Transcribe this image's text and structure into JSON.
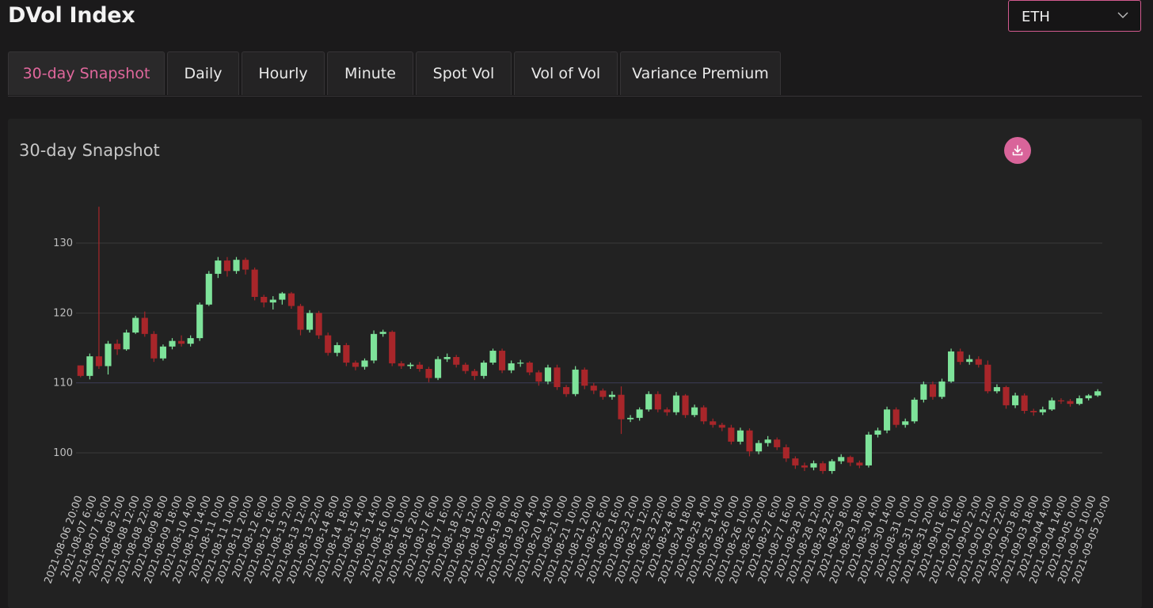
{
  "app": {
    "title": "DVol Index"
  },
  "asset_select": {
    "value": "ETH",
    "icon": "chevron-down-icon"
  },
  "tabs": [
    {
      "label": "30-day Snapshot",
      "active": true
    },
    {
      "label": "Daily",
      "active": false
    },
    {
      "label": "Hourly",
      "active": false
    },
    {
      "label": "Minute",
      "active": false
    },
    {
      "label": "Spot Vol",
      "active": false
    },
    {
      "label": "Vol of Vol",
      "active": false
    },
    {
      "label": "Variance Premium",
      "active": false
    }
  ],
  "panel": {
    "title": "30-day Snapshot",
    "download_icon": "download-icon"
  },
  "colors": {
    "accent": "#e0679c",
    "up": "#7ee39a",
    "down": "#a8262a",
    "grid": "#3a3a3a",
    "highlight_grid": "#3d3d56"
  },
  "chart_data": {
    "type": "candlestick",
    "title": "30-day Snapshot",
    "xlabel": "",
    "ylabel": "",
    "ylim": [
      93,
      137
    ],
    "yticks": [
      100,
      110,
      120,
      130
    ],
    "grid": true,
    "x_start": "2021-08-06 20:00",
    "x_interval_hours": 2,
    "xtick_labels": [
      "2021-08-06  20:00",
      "2021-08-07  6:00",
      "2021-08-07  16:00",
      "2021-08-08  2:00",
      "2021-08-08  12:00",
      "2021-08-08  22:00",
      "2021-08-09  8:00",
      "2021-08-09  18:00",
      "2021-08-10  4:00",
      "2021-08-10  14:00",
      "2021-08-11  0:00",
      "2021-08-11  10:00",
      "2021-08-11  20:00",
      "2021-08-12  6:00",
      "2021-08-12  16:00",
      "2021-08-13  2:00",
      "2021-08-13  12:00",
      "2021-08-13  22:00",
      "2021-08-14  8:00",
      "2021-08-14  18:00",
      "2021-08-15  4:00",
      "2021-08-15  14:00",
      "2021-08-16  0:00",
      "2021-08-16  10:00",
      "2021-08-16  20:00",
      "2021-08-17  6:00",
      "2021-08-17  16:00",
      "2021-08-18  2:00",
      "2021-08-18  12:00",
      "2021-08-18  22:00",
      "2021-08-19  8:00",
      "2021-08-19  18:00",
      "2021-08-20  4:00",
      "2021-08-20  14:00",
      "2021-08-21  0:00",
      "2021-08-21  10:00",
      "2021-08-21  20:00",
      "2021-08-22  6:00",
      "2021-08-22  16:00",
      "2021-08-23  2:00",
      "2021-08-23  12:00",
      "2021-08-23  22:00",
      "2021-08-24  8:00",
      "2021-08-24  18:00",
      "2021-08-25  4:00",
      "2021-08-25  14:00",
      "2021-08-26  0:00",
      "2021-08-26  10:00",
      "2021-08-26  20:00",
      "2021-08-27  6:00",
      "2021-08-27  16:00",
      "2021-08-28  2:00",
      "2021-08-28  12:00",
      "2021-08-28  22:00",
      "2021-08-29  8:00",
      "2021-08-29  18:00",
      "2021-08-30  4:00",
      "2021-08-30  14:00",
      "2021-08-31  0:00",
      "2021-08-31  10:00",
      "2021-08-31  20:00",
      "2021-09-01  6:00",
      "2021-09-01  16:00",
      "2021-09-02  2:00",
      "2021-09-02  12:00",
      "2021-09-02  22:00",
      "2021-09-03  8:00",
      "2021-09-03  18:00",
      "2021-09-04  4:00",
      "2021-09-04  14:00",
      "2021-09-05  0:00",
      "2021-09-05  10:00",
      "2021-09-05  20:00"
    ],
    "candles": [
      [
        112.5,
        111.0,
        112.5,
        110.8
      ],
      [
        111.0,
        113.8,
        114.2,
        110.5
      ],
      [
        113.8,
        112.4,
        135.2,
        112.0
      ],
      [
        112.4,
        115.6,
        116.0,
        111.2
      ],
      [
        115.6,
        114.8,
        116.2,
        114.0
      ],
      [
        114.8,
        117.2,
        117.6,
        114.6
      ],
      [
        117.2,
        119.3,
        119.6,
        117.0
      ],
      [
        119.3,
        117.0,
        120.2,
        116.6
      ],
      [
        117.0,
        113.5,
        117.4,
        113.0
      ],
      [
        113.5,
        115.2,
        115.5,
        113.2
      ],
      [
        115.2,
        116.0,
        116.4,
        114.8
      ],
      [
        116.0,
        115.6,
        116.8,
        115.2
      ],
      [
        115.6,
        116.4,
        116.8,
        115.2
      ],
      [
        116.4,
        121.2,
        121.5,
        116.0
      ],
      [
        121.2,
        125.6,
        126.0,
        121.0
      ],
      [
        125.6,
        127.5,
        128.0,
        125.0
      ],
      [
        127.5,
        126.0,
        128.0,
        125.2
      ],
      [
        126.0,
        127.6,
        128.0,
        125.6
      ],
      [
        127.6,
        126.2,
        127.9,
        125.5
      ],
      [
        126.2,
        122.3,
        126.5,
        121.8
      ],
      [
        122.3,
        121.5,
        122.6,
        120.8
      ],
      [
        121.5,
        121.9,
        122.4,
        120.5
      ],
      [
        121.9,
        122.8,
        123.0,
        121.2
      ],
      [
        122.8,
        121.0,
        123.0,
        120.6
      ],
      [
        121.0,
        117.6,
        121.3,
        116.8
      ],
      [
        117.6,
        120.0,
        120.4,
        117.2
      ],
      [
        120.0,
        116.8,
        120.3,
        116.3
      ],
      [
        116.8,
        114.3,
        117.2,
        113.9
      ],
      [
        114.3,
        115.4,
        115.8,
        113.8
      ],
      [
        115.4,
        112.9,
        115.7,
        112.4
      ],
      [
        112.9,
        112.3,
        113.2,
        111.8
      ],
      [
        112.3,
        113.2,
        113.5,
        111.9
      ],
      [
        113.2,
        117.0,
        117.5,
        112.8
      ],
      [
        117.0,
        117.3,
        117.6,
        116.6
      ],
      [
        117.3,
        112.8,
        117.5,
        112.4
      ],
      [
        112.8,
        112.4,
        113.1,
        112.0
      ],
      [
        112.4,
        112.6,
        112.9,
        112.0
      ],
      [
        112.6,
        112.0,
        113.0,
        111.6
      ],
      [
        112.0,
        110.7,
        112.3,
        110.1
      ],
      [
        110.7,
        113.4,
        113.8,
        110.4
      ],
      [
        113.4,
        113.7,
        114.2,
        113.0
      ],
      [
        113.7,
        112.6,
        114.0,
        112.2
      ],
      [
        112.6,
        111.7,
        112.9,
        111.3
      ],
      [
        111.7,
        111.0,
        112.0,
        110.4
      ],
      [
        111.0,
        112.9,
        113.2,
        110.6
      ],
      [
        112.9,
        114.6,
        114.9,
        112.6
      ],
      [
        114.6,
        111.8,
        114.9,
        111.4
      ],
      [
        111.8,
        112.8,
        113.2,
        111.4
      ],
      [
        112.8,
        112.9,
        113.3,
        112.3
      ],
      [
        112.9,
        111.5,
        113.1,
        111.1
      ],
      [
        111.5,
        110.2,
        111.8,
        109.6
      ],
      [
        110.2,
        112.2,
        112.6,
        109.8
      ],
      [
        112.2,
        109.4,
        112.6,
        109.0
      ],
      [
        109.4,
        108.4,
        109.7,
        108.0
      ],
      [
        108.4,
        111.9,
        112.4,
        108.1
      ],
      [
        111.9,
        109.6,
        112.2,
        109.1
      ],
      [
        109.6,
        108.9,
        110.0,
        108.4
      ],
      [
        108.9,
        108.0,
        109.2,
        107.6
      ],
      [
        108.0,
        108.3,
        108.8,
        107.6
      ],
      [
        108.3,
        104.8,
        109.5,
        102.7
      ],
      [
        104.8,
        105.0,
        105.4,
        104.4
      ],
      [
        105.0,
        106.2,
        106.5,
        104.6
      ],
      [
        106.2,
        108.4,
        108.8,
        105.9
      ],
      [
        108.4,
        106.2,
        108.8,
        105.8
      ],
      [
        106.2,
        105.8,
        106.5,
        105.3
      ],
      [
        105.8,
        108.2,
        108.7,
        105.4
      ],
      [
        108.2,
        105.4,
        108.4,
        105.0
      ],
      [
        105.4,
        106.5,
        106.9,
        105.1
      ],
      [
        106.5,
        104.5,
        106.8,
        104.1
      ],
      [
        104.5,
        104.0,
        104.9,
        103.6
      ],
      [
        104.0,
        103.6,
        104.3,
        103.1
      ],
      [
        103.6,
        101.6,
        104.0,
        101.2
      ],
      [
        101.6,
        103.2,
        103.6,
        101.2
      ],
      [
        103.2,
        100.2,
        103.5,
        99.5
      ],
      [
        100.2,
        101.4,
        101.8,
        99.8
      ],
      [
        101.4,
        101.9,
        102.4,
        100.9
      ],
      [
        101.9,
        100.8,
        102.2,
        100.4
      ],
      [
        100.8,
        99.2,
        101.2,
        98.7
      ],
      [
        99.2,
        98.2,
        99.5,
        97.7
      ],
      [
        98.2,
        97.9,
        98.6,
        97.4
      ],
      [
        97.9,
        98.5,
        98.9,
        97.5
      ],
      [
        98.5,
        97.4,
        98.8,
        97.0
      ],
      [
        97.4,
        98.8,
        99.1,
        97.0
      ],
      [
        98.8,
        99.4,
        99.8,
        98.4
      ],
      [
        99.4,
        98.6,
        99.6,
        98.1
      ],
      [
        98.6,
        98.2,
        98.9,
        97.8
      ],
      [
        98.2,
        102.6,
        103.0,
        97.9
      ],
      [
        102.6,
        103.2,
        103.6,
        102.2
      ],
      [
        103.2,
        106.2,
        106.6,
        102.8
      ],
      [
        106.2,
        104.0,
        106.5,
        103.6
      ],
      [
        104.0,
        104.5,
        104.9,
        103.6
      ],
      [
        104.5,
        107.6,
        107.9,
        104.2
      ],
      [
        107.6,
        109.8,
        110.2,
        107.2
      ],
      [
        109.8,
        108.0,
        110.2,
        107.6
      ],
      [
        108.0,
        110.2,
        110.6,
        107.7
      ],
      [
        110.2,
        114.5,
        114.9,
        110.0
      ],
      [
        114.5,
        113.0,
        114.9,
        112.6
      ],
      [
        113.0,
        113.4,
        114.0,
        112.6
      ],
      [
        113.4,
        112.6,
        113.8,
        112.2
      ],
      [
        112.6,
        108.8,
        113.2,
        108.5
      ],
      [
        108.8,
        109.4,
        109.8,
        108.5
      ],
      [
        109.4,
        106.8,
        109.6,
        106.3
      ],
      [
        106.8,
        108.2,
        108.6,
        106.4
      ],
      [
        108.2,
        106.0,
        108.5,
        105.6
      ],
      [
        106.0,
        105.8,
        106.3,
        105.3
      ],
      [
        105.8,
        106.2,
        106.6,
        105.4
      ],
      [
        106.2,
        107.5,
        107.9,
        106.0
      ],
      [
        107.5,
        107.4,
        107.8,
        107.0
      ],
      [
        107.4,
        107.0,
        107.7,
        106.6
      ],
      [
        107.0,
        107.8,
        108.2,
        106.8
      ],
      [
        107.8,
        108.2,
        108.4,
        107.5
      ],
      [
        108.2,
        108.8,
        109.1,
        108.0
      ]
    ]
  }
}
